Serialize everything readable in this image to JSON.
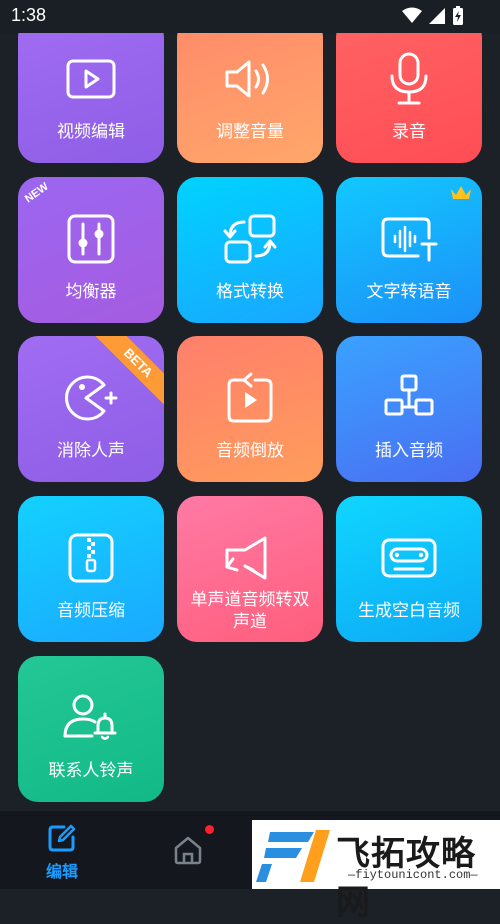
{
  "status_bar": {
    "time": "1:38",
    "icons": [
      "wifi-icon",
      "signal-icon",
      "battery-icon"
    ]
  },
  "tools": [
    {
      "id": "video-edit",
      "label": "视频编辑",
      "icon": "video-play-icon"
    },
    {
      "id": "volume-adjust",
      "label": "调整音量",
      "icon": "speaker-volume-icon"
    },
    {
      "id": "record",
      "label": "录音",
      "icon": "microphone-icon"
    },
    {
      "id": "equalizer",
      "label": "均衡器",
      "icon": "equalizer-sliders-icon",
      "badge": "NEW"
    },
    {
      "id": "format-convert",
      "label": "格式转换",
      "icon": "convert-arrows-icon"
    },
    {
      "id": "text-to-speech",
      "label": "文字转语音",
      "icon": "text-speech-icon",
      "badge_icon": "crown-icon"
    },
    {
      "id": "vocal-remove",
      "label": "消除人声",
      "icon": "pacman-icon",
      "badge": "BETA"
    },
    {
      "id": "audio-reverse",
      "label": "音频倒放",
      "icon": "reverse-play-icon"
    },
    {
      "id": "insert-audio",
      "label": "插入音频",
      "icon": "insert-blocks-icon"
    },
    {
      "id": "audio-compress",
      "label": "音频压缩",
      "icon": "zip-file-icon"
    },
    {
      "id": "mono-to-stereo",
      "label": "单声道音频转双声道",
      "icon": "stereo-speaker-icon"
    },
    {
      "id": "silence-generate",
      "label": "生成空白音频",
      "icon": "cassette-icon"
    },
    {
      "id": "contact-ringtone",
      "label": "联系人铃声",
      "icon": "contact-bell-icon"
    }
  ],
  "bottom_nav": {
    "edit_label": "编辑",
    "items": [
      "edit-icon",
      "home-icon"
    ]
  },
  "watermark": {
    "text": "飞拓攻略网",
    "url": "—fiytounicont.com—"
  }
}
